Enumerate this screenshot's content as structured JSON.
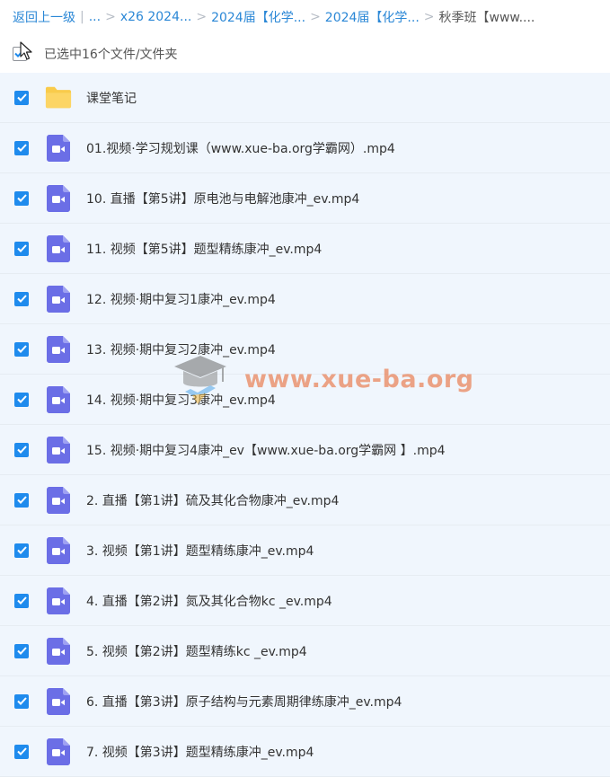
{
  "breadcrumb": {
    "back_label": "返回上一级",
    "ellipsis": "...",
    "crumbs": [
      "x26 2024...",
      "2024届【化学...",
      "2024届【化学..."
    ],
    "current": "秋季班【www...."
  },
  "selection": {
    "summary_text": "已选中16个文件/文件夹"
  },
  "watermark": {
    "text": "www.xue-ba.org"
  },
  "colors": {
    "accent": "#1f8bed",
    "link": "#2a87d6",
    "selected_row": "#f0f6fd",
    "folder": "#f9cb4b",
    "video_icon": "#6b6ee6"
  },
  "files": [
    {
      "name": "课堂笔记",
      "type": "folder-icon",
      "selected": true
    },
    {
      "name": "01.视频·学习规划课（www.xue-ba.org学霸网）.mp4",
      "type": "video-file-icon",
      "selected": true
    },
    {
      "name": "10. 直播【第5讲】原电池与电解池康冲_ev.mp4",
      "type": "video-file-icon",
      "selected": true
    },
    {
      "name": "11. 视频【第5讲】题型精练康冲_ev.mp4",
      "type": "video-file-icon",
      "selected": true
    },
    {
      "name": "12. 视频·期中复习1康冲_ev.mp4",
      "type": "video-file-icon",
      "selected": true
    },
    {
      "name": "13. 视频·期中复习2康冲_ev.mp4",
      "type": "video-file-icon",
      "selected": true
    },
    {
      "name": "14. 视频·期中复习3康冲_ev.mp4",
      "type": "video-file-icon",
      "selected": true
    },
    {
      "name": "15. 视频·期中复习4康冲_ev【www.xue-ba.org学霸网 】.mp4",
      "type": "video-file-icon",
      "selected": true
    },
    {
      "name": "2. 直播【第1讲】硫及其化合物康冲_ev.mp4",
      "type": "video-file-icon",
      "selected": true
    },
    {
      "name": "3. 视频【第1讲】题型精练康冲_ev.mp4",
      "type": "video-file-icon",
      "selected": true
    },
    {
      "name": "4. 直播【第2讲】氮及其化合物kc _ev.mp4",
      "type": "video-file-icon",
      "selected": true
    },
    {
      "name": "5. 视频【第2讲】题型精练kc _ev.mp4",
      "type": "video-file-icon",
      "selected": true
    },
    {
      "name": "6. 直播【第3讲】原子结构与元素周期律练康冲_ev.mp4",
      "type": "video-file-icon",
      "selected": true
    },
    {
      "name": "7. 视频【第3讲】题型精练康冲_ev.mp4",
      "type": "video-file-icon",
      "selected": true
    }
  ]
}
